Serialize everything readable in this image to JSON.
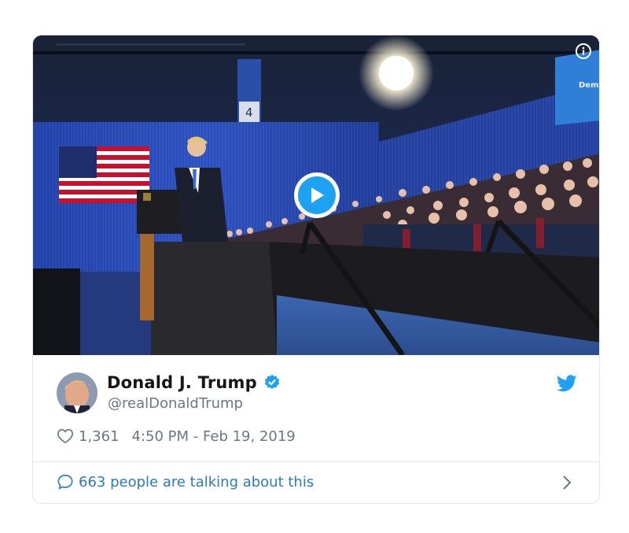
{
  "tweet": {
    "author": {
      "display_name": "Donald J. Trump",
      "handle": "@realDonaldTrump",
      "verified": true
    },
    "likes": "1,361",
    "timestamp": "4:50 PM - Feb 19, 2019",
    "talking": "663 people are talking about this"
  },
  "media": {
    "type": "video",
    "podium_number": "4",
    "screen_text": "Demo"
  },
  "icons": {
    "info": "info-icon",
    "play": "play-icon",
    "verified": "verified-badge-icon",
    "brand": "twitter-bird-icon",
    "like": "heart-icon",
    "reply": "speech-bubble-icon",
    "more": "chevron-right-icon"
  },
  "colors": {
    "twitter_blue": "#1da1f2",
    "link_blue": "#2b7bb9",
    "text_dark": "#14171a",
    "text_gray": "#697882",
    "border": "#e1e8ed"
  }
}
